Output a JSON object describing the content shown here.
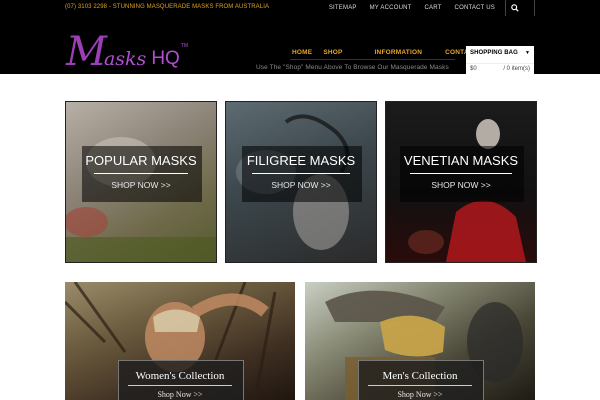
{
  "topbar": {
    "phone_text": "(07) 3103 2298 - STUNNING MASQUERADE MASKS FROM AUSTRALIA",
    "links": [
      "SITEMAP",
      "MY ACCOUNT",
      "CART",
      "CONTACT US"
    ],
    "search_icon": "search-icon"
  },
  "logo": {
    "m": "M",
    "asks": "asks",
    "hq": "HQ",
    "tm": "TM"
  },
  "nav": {
    "items": [
      "HOME",
      "SHOP",
      "INFORMATION",
      "CONTACT US"
    ],
    "hint": "Use The \"Shop\" Menu Above To Browse Our Masquerade Masks"
  },
  "bag": {
    "title": "SHOPPING BAG",
    "total": "$0",
    "count": "/ 0 item(s)"
  },
  "tiles": [
    {
      "title": "POPULAR MASKS",
      "cta": "SHOP NOW >>"
    },
    {
      "title": "FILIGREE MASKS",
      "cta": "SHOP NOW >>"
    },
    {
      "title": "VENETIAN MASKS",
      "cta": "SHOP NOW >>"
    },
    {
      "title": "Women's Collection",
      "cta": "Shop Now >>"
    },
    {
      "title": "Men's Collection",
      "cta": "Shop Now >>"
    }
  ],
  "colors": {
    "accent": "#e8a62a",
    "logo": "#b04fd0",
    "bar": "#000000"
  }
}
